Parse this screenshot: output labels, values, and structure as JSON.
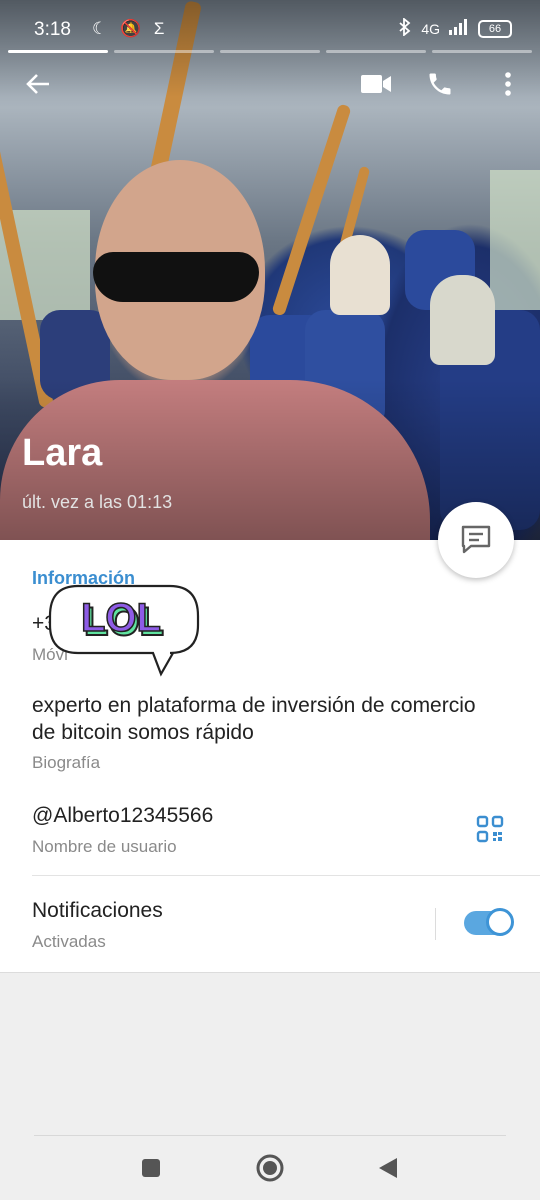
{
  "status_bar": {
    "time": "3:18",
    "left_icons": "☾ 🔕 Σ",
    "network": "4G",
    "battery": "66"
  },
  "toolbar": {
    "back_icon": "arrow-left-icon",
    "video_icon": "video-camera-icon",
    "call_icon": "phone-icon",
    "more_icon": "kebab-menu-icon"
  },
  "profile": {
    "name": "Lara",
    "last_seen": "últ. vez a las 01:13"
  },
  "info": {
    "section_title": "Información",
    "phone_value": "+3",
    "phone_label": "Móvi",
    "bio_line1": "experto en plataforma de inversión de comercio",
    "bio_line2": "de bitcoin somos rápido",
    "bio_label": "Biografía",
    "username": "@Alberto12345566",
    "username_label": "Nombre de usuario",
    "notifications_title": "Notificaciones",
    "notifications_status": "Activadas",
    "notifications_enabled": true
  },
  "sticker": {
    "text": "LOL"
  },
  "colors": {
    "accent": "#3b8ed0",
    "sticker_purple": "#8e5ce6",
    "sticker_green": "#5fe3a0"
  }
}
